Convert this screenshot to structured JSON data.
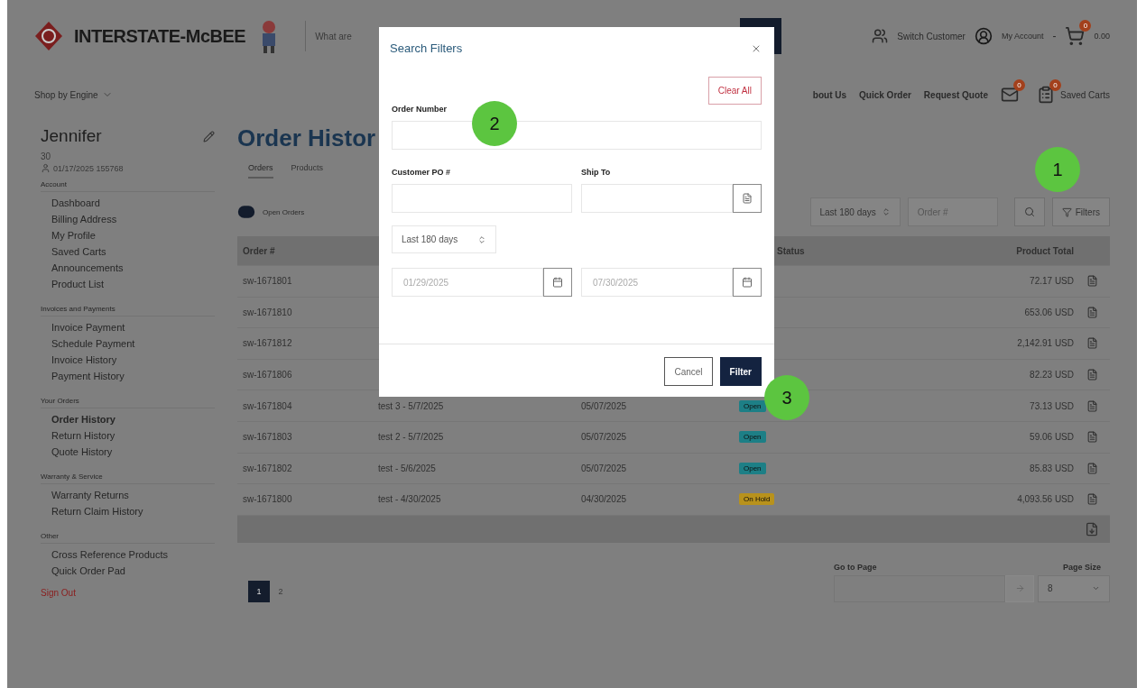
{
  "header": {
    "logo": "INTERSTATE-McBEE",
    "search_placeholder": "What are",
    "switch_customer": "Switch Customer",
    "my_account": "My Account",
    "separator": "-",
    "cart_badge": "0",
    "cart_total": "0.00"
  },
  "nav": {
    "shop_by": "Shop by Engine",
    "links": [
      "bout Us",
      "Quick Order",
      "Request Quote"
    ],
    "messages_badge": "0",
    "saved_carts_badge": "0",
    "saved_carts": "Saved Carts"
  },
  "sidebar": {
    "name": "Jennifer",
    "line": "30",
    "account": "01/17/2025 155768",
    "sections": [
      {
        "title": "Account",
        "items": [
          {
            "label": "Dashboard",
            "selected": false
          },
          {
            "label": "Billing Address",
            "selected": false
          },
          {
            "label": "My Profile",
            "selected": false
          },
          {
            "label": "Saved Carts",
            "selected": false
          },
          {
            "label": "Announcements",
            "selected": false
          },
          {
            "label": "Product List",
            "selected": false
          }
        ]
      },
      {
        "title": "Invoices and Payments",
        "items": [
          {
            "label": "Invoice Payment",
            "selected": false
          },
          {
            "label": "Schedule Payment",
            "selected": false
          },
          {
            "label": "Invoice History",
            "selected": false
          },
          {
            "label": "Payment History",
            "selected": false
          }
        ]
      },
      {
        "title": "Your Orders",
        "items": [
          {
            "label": "Order History",
            "selected": true
          },
          {
            "label": "Return History",
            "selected": false
          },
          {
            "label": "Quote History",
            "selected": false
          }
        ]
      },
      {
        "title": "Warranty & Service",
        "items": [
          {
            "label": "Warranty Returns",
            "selected": false
          },
          {
            "label": "Return Claim History",
            "selected": false
          }
        ]
      },
      {
        "title": "Other",
        "items": [
          {
            "label": "Cross Reference Products",
            "selected": false
          },
          {
            "label": "Quick Order Pad",
            "selected": false
          }
        ]
      }
    ],
    "sign_out": "Sign Out"
  },
  "main": {
    "title": "Order Histor",
    "tabs": [
      {
        "label": "Orders",
        "selected": true
      },
      {
        "label": "Products",
        "selected": false
      }
    ],
    "open_orders": "Open Orders",
    "range": "Last 180 days",
    "order_placeholder": "Order #",
    "filters": "Filters",
    "columns": [
      "Order #",
      "Status",
      "Product Total"
    ],
    "rows": [
      {
        "order": "sw-1671801",
        "total": "72.17 USD"
      },
      {
        "order": "sw-1671810",
        "total": "653.06 USD"
      },
      {
        "order": "sw-1671812",
        "total": "2,142.91 USD"
      },
      {
        "order": "sw-1671806",
        "total": "82.23 USD"
      },
      {
        "order": "sw-1671804",
        "po": "test 3 - 5/7/2025",
        "date": "05/07/2025",
        "status": {
          "label": "Open",
          "color": "#1d7f86"
        },
        "total": "73.13 USD"
      },
      {
        "order": "sw-1671803",
        "po": "test 2 - 5/7/2025",
        "date": "05/07/2025",
        "status": {
          "label": "Open",
          "color": "#1d7f86"
        },
        "total": "59.06 USD"
      },
      {
        "order": "sw-1671802",
        "po": "test - 5/6/2025",
        "date": "05/07/2025",
        "status": {
          "label": "Open",
          "color": "#1d7f86"
        },
        "total": "85.83 USD"
      },
      {
        "order": "sw-1671800",
        "po": "test - 4/30/2025",
        "date": "04/30/2025",
        "status": {
          "label": "On Hold",
          "color": "#b8921c"
        },
        "total": "4,093.56 USD"
      }
    ],
    "pages": [
      {
        "label": "1",
        "selected": true
      },
      {
        "label": "2",
        "selected": false
      }
    ],
    "go_to_page": "Go to Page",
    "page_size_label": "Page Size",
    "page_size": "8"
  },
  "modal": {
    "title": "Search Filters",
    "clear_all": "Clear All",
    "order_number": "Order Number",
    "customer_po": "Customer PO #",
    "ship_to": "Ship To",
    "range": "Last 180 days",
    "date_from": "01/29/2025",
    "date_to": "07/30/2025",
    "cancel": "Cancel",
    "filter": "Filter"
  },
  "markers": [
    "1",
    "2",
    "3"
  ]
}
